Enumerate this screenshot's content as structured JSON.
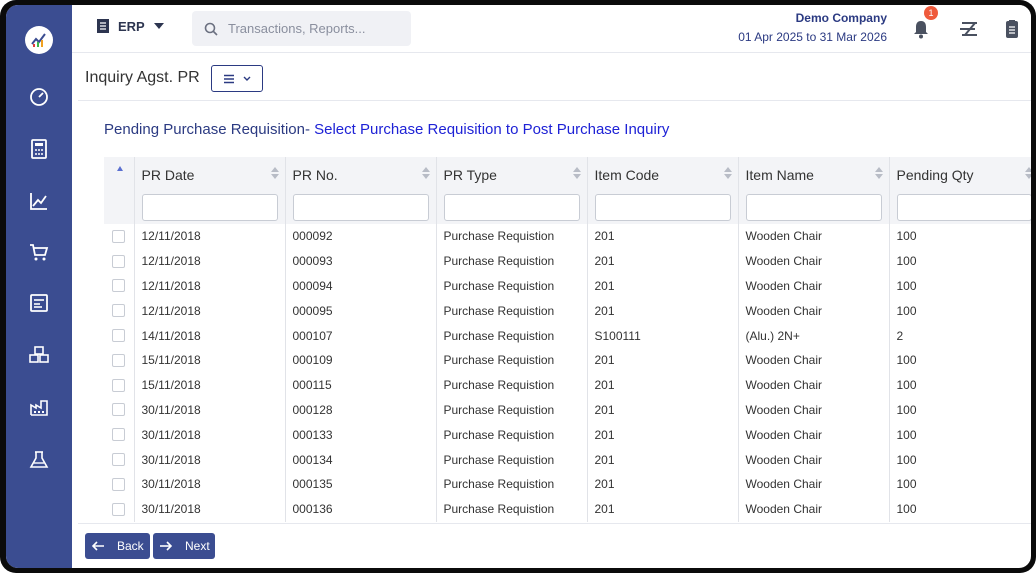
{
  "topbar": {
    "module_label": "ERP",
    "search_placeholder": "Transactions, Reports...",
    "company_name": "Demo Company",
    "period": "01 Apr 2025 to 31 Mar 2026",
    "notification_count": "1"
  },
  "subbar": {
    "page_title": "Inquiry Agst. PR"
  },
  "heading": {
    "part1": "Pending Purchase Requisition- ",
    "part2": "Select Purchase Requisition to Post Purchase Inquiry"
  },
  "table": {
    "columns": [
      "PR Date",
      "PR No.",
      "PR Type",
      "Item Code",
      "Item Name",
      "Pending Qty"
    ],
    "rows": [
      [
        "12/11/2018",
        "000092",
        "Purchase Requistion",
        "201",
        "Wooden Chair",
        "100"
      ],
      [
        "12/11/2018",
        "000093",
        "Purchase Requistion",
        "201",
        "Wooden Chair",
        "100"
      ],
      [
        "12/11/2018",
        "000094",
        "Purchase Requistion",
        "201",
        "Wooden Chair",
        "100"
      ],
      [
        "12/11/2018",
        "000095",
        "Purchase Requistion",
        "201",
        "Wooden Chair",
        "100"
      ],
      [
        "14/11/2018",
        "000107",
        "Purchase Requistion",
        "S100111",
        "(Alu.) 2N+",
        "2"
      ],
      [
        "15/11/2018",
        "000109",
        "Purchase Requistion",
        "201",
        "Wooden Chair",
        "100"
      ],
      [
        "15/11/2018",
        "000115",
        "Purchase Requistion",
        "201",
        "Wooden Chair",
        "100"
      ],
      [
        "30/11/2018",
        "000128",
        "Purchase Requistion",
        "201",
        "Wooden Chair",
        "100"
      ],
      [
        "30/11/2018",
        "000133",
        "Purchase Requistion",
        "201",
        "Wooden Chair",
        "100"
      ],
      [
        "30/11/2018",
        "000134",
        "Purchase Requistion",
        "201",
        "Wooden Chair",
        "100"
      ],
      [
        "30/11/2018",
        "000135",
        "Purchase Requistion",
        "201",
        "Wooden Chair",
        "100"
      ],
      [
        "30/11/2018",
        "000136",
        "Purchase Requistion",
        "201",
        "Wooden Chair",
        "100"
      ]
    ]
  },
  "footer": {
    "back_label": "Back",
    "next_label": "Next"
  },
  "colors": {
    "sidebar": "#3b4d91",
    "accent": "#2b3a82",
    "heading_link": "#1e22d6",
    "badge": "#ef5a3c"
  }
}
